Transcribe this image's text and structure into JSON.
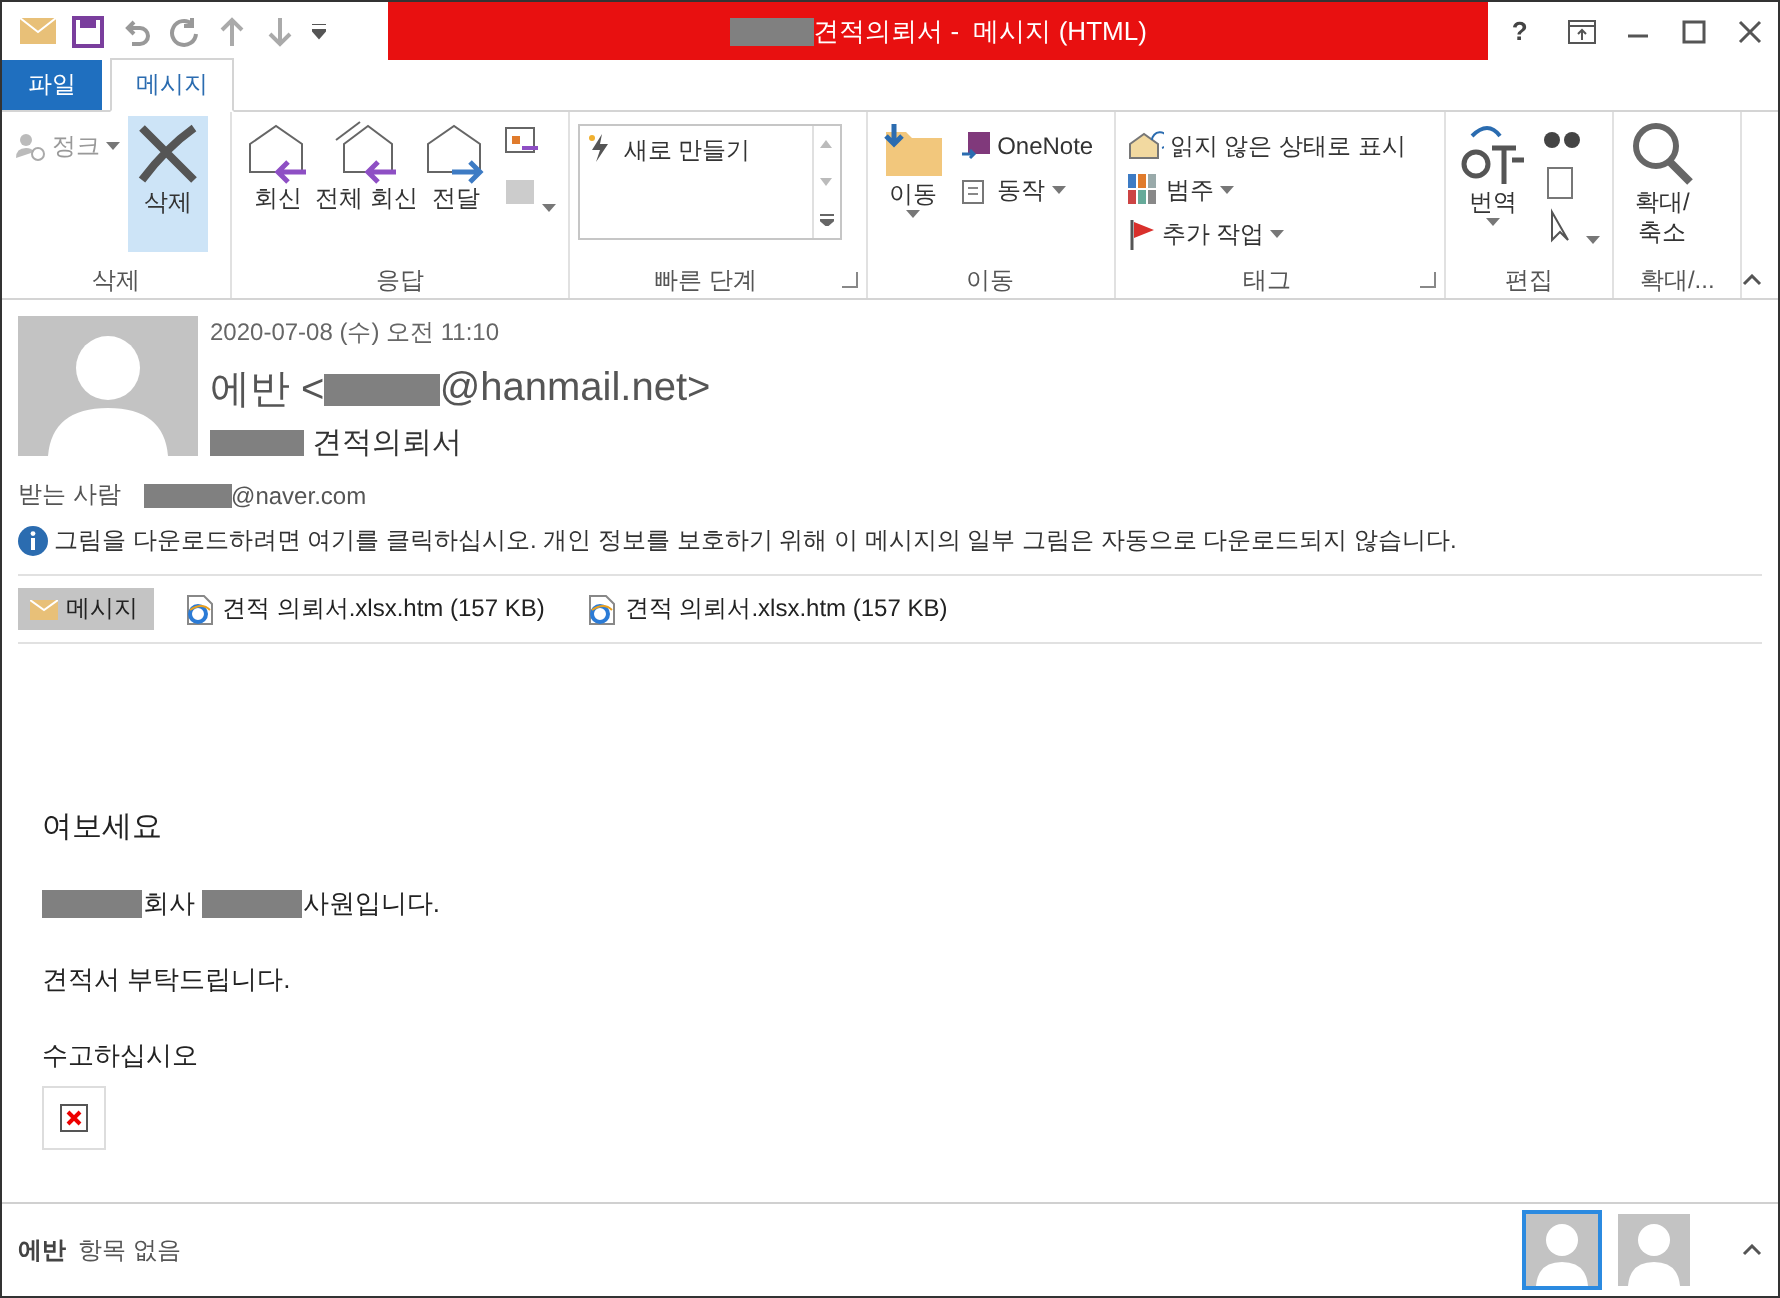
{
  "window": {
    "title": [
      {
        "kind": "redaction"
      },
      {
        "kind": "text",
        "text": "견적의뢰서 -  메시지 (HTML)"
      }
    ],
    "controls": [
      "?"
    ]
  },
  "tabs": [
    {
      "label": "파일",
      "kind": "file",
      "selected": false
    },
    {
      "label": "메시지",
      "kind": "tab",
      "selected": true
    }
  ],
  "ribbon": {
    "groups": [
      {
        "label": "삭제",
        "launcher": false,
        "items": [
          {
            "kind": "small",
            "label": "정크",
            "dropdown": true,
            "disabled": true,
            "selected": false
          },
          {
            "kind": "large",
            "label": "삭제",
            "dropdown": false,
            "disabled": false,
            "selected": true
          }
        ]
      },
      {
        "label": "응답",
        "launcher": false,
        "items": [
          {
            "kind": "large",
            "label": "회신",
            "dropdown": false,
            "disabled": false,
            "selected": false
          },
          {
            "kind": "large",
            "label": "전체 회신",
            "dropdown": false,
            "disabled": false,
            "selected": false
          },
          {
            "kind": "large",
            "label": "전달",
            "dropdown": false,
            "disabled": false,
            "selected": false
          },
          {
            "kind": "iconstack",
            "dropdown": true,
            "disabled": false,
            "selected": false
          }
        ]
      },
      {
        "label": "빠른 단계",
        "launcher": true,
        "items": [
          {
            "kind": "gallery",
            "label": "새로 만들기",
            "dropdown": false,
            "disabled": false,
            "selected": false
          }
        ]
      },
      {
        "label": "이동",
        "launcher": false,
        "items": [
          {
            "kind": "large",
            "label": "이동",
            "dropdown": true,
            "disabled": false,
            "selected": false
          },
          {
            "kind": "small",
            "label": "OneNote",
            "dropdown": false,
            "disabled": false,
            "selected": false
          },
          {
            "kind": "small",
            "label": "동작",
            "dropdown": true,
            "disabled": false,
            "selected": false
          }
        ]
      },
      {
        "label": "태그",
        "launcher": true,
        "items": [
          {
            "kind": "small",
            "label": "읽지 않은 상태로 표시",
            "dropdown": false,
            "disabled": false,
            "selected": false
          },
          {
            "kind": "small",
            "label": "범주",
            "dropdown": true,
            "disabled": false,
            "selected": false
          },
          {
            "kind": "small",
            "label": "추가 작업",
            "dropdown": true,
            "disabled": false,
            "selected": false
          }
        ]
      },
      {
        "label": "편집",
        "launcher": false,
        "items": [
          {
            "kind": "large",
            "label": "번역",
            "dropdown": true,
            "disabled": false,
            "selected": false
          },
          {
            "kind": "iconstack",
            "dropdown": true,
            "disabled": false,
            "selected": false
          }
        ]
      },
      {
        "label": "확대/...",
        "launcher": false,
        "items": [
          {
            "kind": "large",
            "label": "확대/\n축소",
            "dropdown": false,
            "disabled": false,
            "selected": false
          }
        ]
      }
    ]
  },
  "header": {
    "date": "2020-07-08 (수) 오전 11:10",
    "sender": [
      {
        "kind": "text",
        "text": "에반 <"
      },
      {
        "kind": "redaction"
      },
      {
        "kind": "text",
        "text": "@hanmail.net>"
      }
    ],
    "subject": [
      {
        "kind": "redaction"
      },
      {
        "kind": "text",
        "text": " 견적의뢰서"
      }
    ],
    "to_label": "받는 사람",
    "to": [
      {
        "kind": "redaction"
      },
      {
        "kind": "text",
        "text": "@naver.com"
      }
    ],
    "info": "그림을 다운로드하려면 여기를 클릭하십시오. 개인 정보를 보호하기 위해 이 메시지의 일부 그림은 자동으로 다운로드되지 않습니다."
  },
  "attachments": [
    {
      "kind": "message",
      "label": "메시지",
      "selected": true
    },
    {
      "kind": "file",
      "label": "견적 의뢰서.xlsx.htm (157 KB)",
      "selected": false
    },
    {
      "kind": "file",
      "label": "견적 의뢰서.xlsx.htm (157 KB)",
      "selected": false
    }
  ],
  "body": [
    {
      "kind": "greeting",
      "segments": [
        {
          "kind": "text",
          "text": "여보세요"
        }
      ]
    },
    {
      "kind": "line",
      "segments": [
        {
          "kind": "redaction"
        },
        {
          "kind": "text",
          "text": "회사 "
        },
        {
          "kind": "redaction"
        },
        {
          "kind": "text",
          "text": "사원입니다."
        }
      ]
    },
    {
      "kind": "line",
      "segments": [
        {
          "kind": "text",
          "text": "견적서 부탁드립니다."
        }
      ]
    },
    {
      "kind": "line",
      "segments": [
        {
          "kind": "text",
          "text": "수고하십시오"
        }
      ]
    }
  ],
  "people_pane": {
    "name": "에반",
    "status": "항목 없음",
    "avatars": [
      {
        "selected": true
      },
      {
        "selected": false
      }
    ]
  }
}
